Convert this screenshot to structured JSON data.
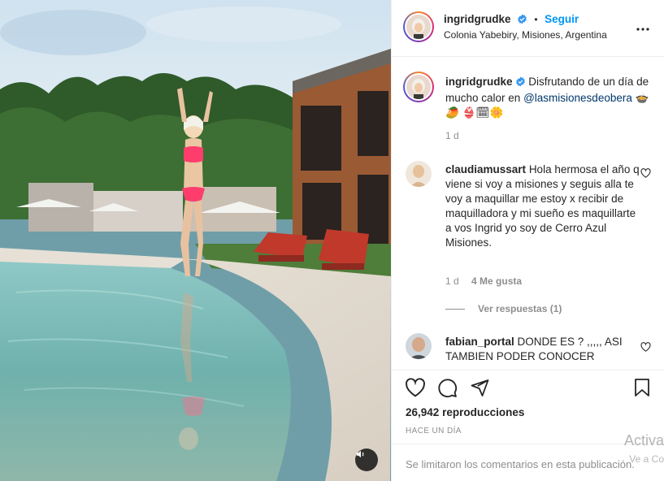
{
  "post": {
    "username": "ingridgrudke",
    "follow_label": "Seguir",
    "location": "Colonia Yabebiry, Misiones, Argentina",
    "caption_text": "Disfrutando de un día de mucho calor en",
    "caption_mention": "@lasmisionesdeobera",
    "caption_emojis": "🍲 🥭 👙🗓🌼",
    "caption_age": "1 d"
  },
  "comments": [
    {
      "username": "claudiamussart",
      "text": "Hola hermosa el año q viene si voy a misiones y seguis alla te voy a maquillar me estoy x recibir de maquilladora y mi sueño es maquillarte a vos Ingrid yo soy de Cerro Azul Misiones.",
      "age": "1 d",
      "likes": "4 Me gusta",
      "replies_label": "Ver respuestas (1)"
    },
    {
      "username": "fabian_portal",
      "text": "DONDE ES ? ,,,,, ASI TAMBIEN PODER CONOCER"
    }
  ],
  "stats": {
    "views_count": "26,942",
    "views_label": "reproducciones",
    "date": "HACE UN DÍA",
    "comments_limited": "Se limitaron los comentarios en esta publicación."
  },
  "watermark": {
    "line1": "Activa",
    "line2": "Ve a Co"
  },
  "icons": {
    "verified": "verified-badge-icon",
    "more": "more-options-icon",
    "like": "heart-icon",
    "comment": "comment-icon",
    "share": "paper-plane-icon",
    "save": "bookmark-icon",
    "mute": "speaker-icon"
  },
  "colors": {
    "accent": "#0095f6",
    "verified": "#3897f0",
    "muted_text": "#8e8e8e",
    "border": "#efefef"
  }
}
